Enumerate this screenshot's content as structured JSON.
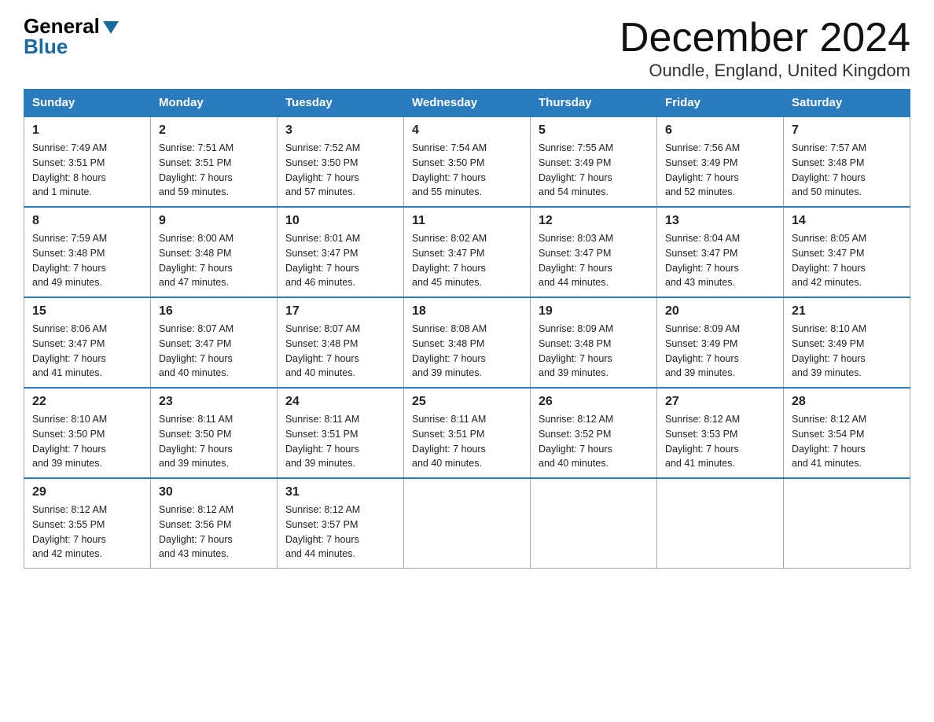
{
  "header": {
    "logo_general": "General",
    "logo_blue": "Blue",
    "month_title": "December 2024",
    "location": "Oundle, England, United Kingdom"
  },
  "days_of_week": [
    "Sunday",
    "Monday",
    "Tuesday",
    "Wednesday",
    "Thursday",
    "Friday",
    "Saturday"
  ],
  "weeks": [
    [
      {
        "num": "1",
        "sunrise": "7:49 AM",
        "sunset": "3:51 PM",
        "daylight": "8 hours and 1 minute."
      },
      {
        "num": "2",
        "sunrise": "7:51 AM",
        "sunset": "3:51 PM",
        "daylight": "7 hours and 59 minutes."
      },
      {
        "num": "3",
        "sunrise": "7:52 AM",
        "sunset": "3:50 PM",
        "daylight": "7 hours and 57 minutes."
      },
      {
        "num": "4",
        "sunrise": "7:54 AM",
        "sunset": "3:50 PM",
        "daylight": "7 hours and 55 minutes."
      },
      {
        "num": "5",
        "sunrise": "7:55 AM",
        "sunset": "3:49 PM",
        "daylight": "7 hours and 54 minutes."
      },
      {
        "num": "6",
        "sunrise": "7:56 AM",
        "sunset": "3:49 PM",
        "daylight": "7 hours and 52 minutes."
      },
      {
        "num": "7",
        "sunrise": "7:57 AM",
        "sunset": "3:48 PM",
        "daylight": "7 hours and 50 minutes."
      }
    ],
    [
      {
        "num": "8",
        "sunrise": "7:59 AM",
        "sunset": "3:48 PM",
        "daylight": "7 hours and 49 minutes."
      },
      {
        "num": "9",
        "sunrise": "8:00 AM",
        "sunset": "3:48 PM",
        "daylight": "7 hours and 47 minutes."
      },
      {
        "num": "10",
        "sunrise": "8:01 AM",
        "sunset": "3:47 PM",
        "daylight": "7 hours and 46 minutes."
      },
      {
        "num": "11",
        "sunrise": "8:02 AM",
        "sunset": "3:47 PM",
        "daylight": "7 hours and 45 minutes."
      },
      {
        "num": "12",
        "sunrise": "8:03 AM",
        "sunset": "3:47 PM",
        "daylight": "7 hours and 44 minutes."
      },
      {
        "num": "13",
        "sunrise": "8:04 AM",
        "sunset": "3:47 PM",
        "daylight": "7 hours and 43 minutes."
      },
      {
        "num": "14",
        "sunrise": "8:05 AM",
        "sunset": "3:47 PM",
        "daylight": "7 hours and 42 minutes."
      }
    ],
    [
      {
        "num": "15",
        "sunrise": "8:06 AM",
        "sunset": "3:47 PM",
        "daylight": "7 hours and 41 minutes."
      },
      {
        "num": "16",
        "sunrise": "8:07 AM",
        "sunset": "3:47 PM",
        "daylight": "7 hours and 40 minutes."
      },
      {
        "num": "17",
        "sunrise": "8:07 AM",
        "sunset": "3:48 PM",
        "daylight": "7 hours and 40 minutes."
      },
      {
        "num": "18",
        "sunrise": "8:08 AM",
        "sunset": "3:48 PM",
        "daylight": "7 hours and 39 minutes."
      },
      {
        "num": "19",
        "sunrise": "8:09 AM",
        "sunset": "3:48 PM",
        "daylight": "7 hours and 39 minutes."
      },
      {
        "num": "20",
        "sunrise": "8:09 AM",
        "sunset": "3:49 PM",
        "daylight": "7 hours and 39 minutes."
      },
      {
        "num": "21",
        "sunrise": "8:10 AM",
        "sunset": "3:49 PM",
        "daylight": "7 hours and 39 minutes."
      }
    ],
    [
      {
        "num": "22",
        "sunrise": "8:10 AM",
        "sunset": "3:50 PM",
        "daylight": "7 hours and 39 minutes."
      },
      {
        "num": "23",
        "sunrise": "8:11 AM",
        "sunset": "3:50 PM",
        "daylight": "7 hours and 39 minutes."
      },
      {
        "num": "24",
        "sunrise": "8:11 AM",
        "sunset": "3:51 PM",
        "daylight": "7 hours and 39 minutes."
      },
      {
        "num": "25",
        "sunrise": "8:11 AM",
        "sunset": "3:51 PM",
        "daylight": "7 hours and 40 minutes."
      },
      {
        "num": "26",
        "sunrise": "8:12 AM",
        "sunset": "3:52 PM",
        "daylight": "7 hours and 40 minutes."
      },
      {
        "num": "27",
        "sunrise": "8:12 AM",
        "sunset": "3:53 PM",
        "daylight": "7 hours and 41 minutes."
      },
      {
        "num": "28",
        "sunrise": "8:12 AM",
        "sunset": "3:54 PM",
        "daylight": "7 hours and 41 minutes."
      }
    ],
    [
      {
        "num": "29",
        "sunrise": "8:12 AM",
        "sunset": "3:55 PM",
        "daylight": "7 hours and 42 minutes."
      },
      {
        "num": "30",
        "sunrise": "8:12 AM",
        "sunset": "3:56 PM",
        "daylight": "7 hours and 43 minutes."
      },
      {
        "num": "31",
        "sunrise": "8:12 AM",
        "sunset": "3:57 PM",
        "daylight": "7 hours and 44 minutes."
      },
      null,
      null,
      null,
      null
    ]
  ],
  "labels": {
    "sunrise": "Sunrise: ",
    "sunset": "Sunset: ",
    "daylight": "Daylight: "
  }
}
